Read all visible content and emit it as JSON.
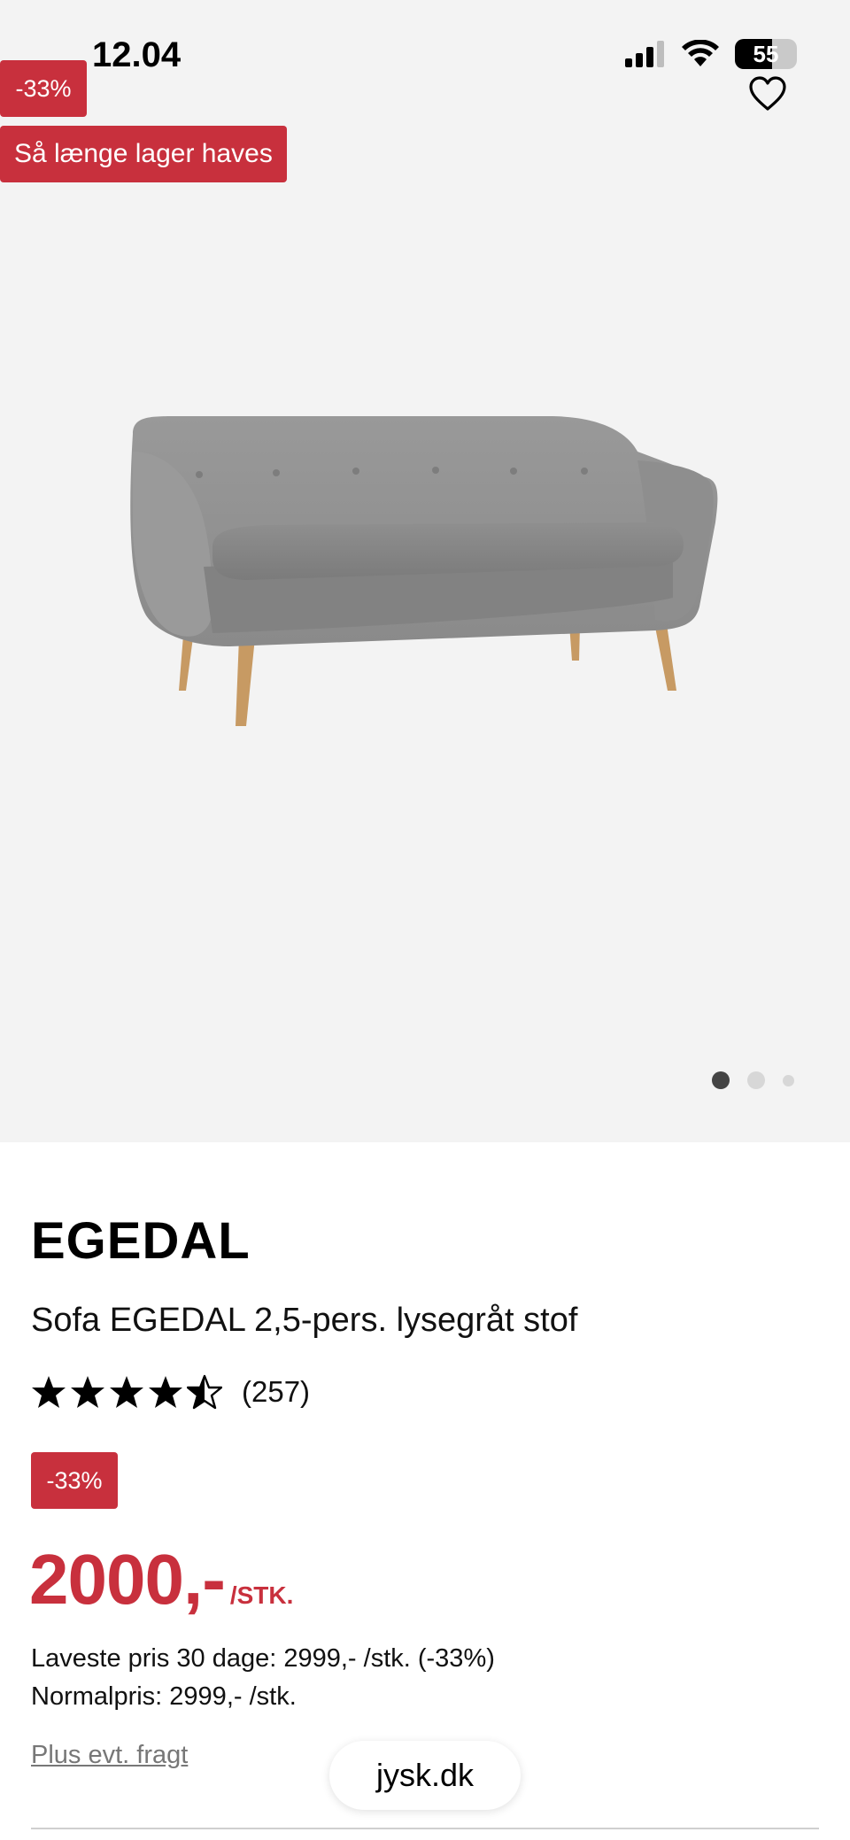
{
  "status_bar": {
    "time": "12.04",
    "battery": "55",
    "icons": [
      "cellular-signal-icon",
      "wifi-icon",
      "battery-icon"
    ]
  },
  "hero": {
    "discount_badge": "-33%",
    "stock_badge": "Så længe lager haves",
    "favorite_icon": "heart-icon",
    "image": "sofa-image",
    "carousel": {
      "count": 3,
      "active_index": 0
    }
  },
  "product": {
    "brand": "EGEDAL",
    "name": "Sofa EGEDAL 2,5-pers. lysegråt stof",
    "rating": {
      "value": 4.5,
      "max": 5,
      "count": "(257)"
    },
    "discount_badge": "-33%",
    "price": "2000,-",
    "price_unit": "/STK.",
    "lowest_price": "Laveste pris 30 dage: 2999,- /stk. (-33%)",
    "normal_price": "Normalpris: 2999,- /stk.",
    "freight_link": "Plus evt. fragt"
  },
  "browser": {
    "url": "jysk.dk"
  },
  "colors": {
    "accent": "#c8303d",
    "hero_bg": "#f3f3f3"
  }
}
